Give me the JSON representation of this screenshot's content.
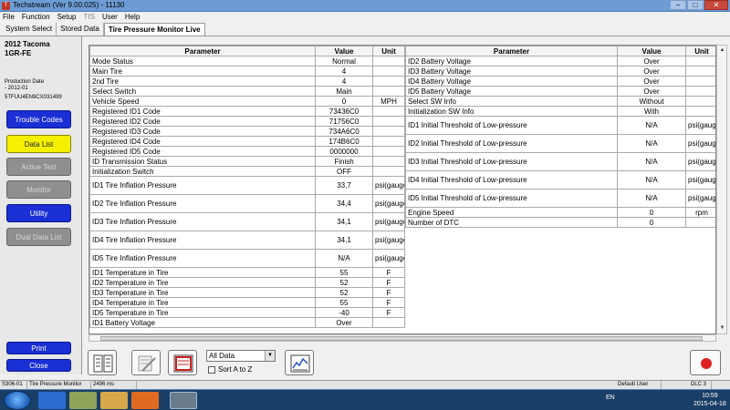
{
  "window": {
    "title": "Techstream (Ver 9.00.025) - 11130"
  },
  "menu": [
    "File",
    "Function",
    "Setup",
    "TIS",
    "User",
    "Help"
  ],
  "tabs": [
    "System Select",
    "Stored Data",
    "Tire Pressure Monitor Live"
  ],
  "vehicle": {
    "model_line1": "2012 Tacoma",
    "model_line2": "1GR-FE",
    "production_label": "Production Date",
    "production_date": "- 2012-01",
    "vin": "5TFUU4EN9CX031499"
  },
  "left_buttons": {
    "trouble_codes": "Trouble Codes",
    "data_list": "Data List",
    "active_test": "Active Test",
    "monitor": "Monitor",
    "utility": "Utility",
    "dual_data_list": "Dual Data List",
    "print": "Print",
    "close": "Close"
  },
  "table_headers": {
    "parameter": "Parameter",
    "value": "Value",
    "unit": "Unit"
  },
  "left_table": [
    {
      "param": "Mode Status",
      "value": "Normal",
      "unit": ""
    },
    {
      "param": "Main Tire",
      "value": "4",
      "unit": ""
    },
    {
      "param": "2nd Tire",
      "value": "4",
      "unit": ""
    },
    {
      "param": "Select Switch",
      "value": "Main",
      "unit": ""
    },
    {
      "param": "Vehicle Speed",
      "value": "0",
      "unit": "MPH"
    },
    {
      "param": "Registered ID1 Code",
      "value": "73436C0",
      "unit": ""
    },
    {
      "param": "Registered ID2 Code",
      "value": "71756C0",
      "unit": ""
    },
    {
      "param": "Registered ID3 Code",
      "value": "734A6C0",
      "unit": ""
    },
    {
      "param": "Registered ID4 Code",
      "value": "174B6C0",
      "unit": ""
    },
    {
      "param": "Registered ID5 Code",
      "value": "0000000",
      "unit": ""
    },
    {
      "param": "ID Transmission Status",
      "value": "Finish",
      "unit": ""
    },
    {
      "param": "Initialization Switch",
      "value": "OFF",
      "unit": ""
    },
    {
      "param": "ID1 Tire Inflation Pressure",
      "value": "33,7",
      "unit": "psi(gauge)"
    },
    {
      "param": "ID2 Tire Inflation Pressure",
      "value": "34,4",
      "unit": "psi(gauge)"
    },
    {
      "param": "ID3 Tire Inflation Pressure",
      "value": "34,1",
      "unit": "psi(gauge)"
    },
    {
      "param": "ID4 Tire Inflation Pressure",
      "value": "34,1",
      "unit": "psi(gauge)"
    },
    {
      "param": "ID5 Tire Inflation Pressure",
      "value": "N/A",
      "unit": "psi(gauge)"
    },
    {
      "param": "ID1 Temperature in Tire",
      "value": "55",
      "unit": "F"
    },
    {
      "param": "ID2 Temperature in Tire",
      "value": "52",
      "unit": "F"
    },
    {
      "param": "ID3 Temperature in Tire",
      "value": "52",
      "unit": "F"
    },
    {
      "param": "ID4 Temperature in Tire",
      "value": "55",
      "unit": "F"
    },
    {
      "param": "ID5 Temperature in Tire",
      "value": "-40",
      "unit": "F"
    },
    {
      "param": "ID1 Battery Voltage",
      "value": "Over",
      "unit": ""
    }
  ],
  "right_table": [
    {
      "param": "ID2 Battery Voltage",
      "value": "Over",
      "unit": ""
    },
    {
      "param": "ID3 Battery Voltage",
      "value": "Over",
      "unit": ""
    },
    {
      "param": "ID4 Battery Voltage",
      "value": "Over",
      "unit": ""
    },
    {
      "param": "ID5 Battery Voltage",
      "value": "Over",
      "unit": ""
    },
    {
      "param": "Select SW Info",
      "value": "Without",
      "unit": ""
    },
    {
      "param": "Initialization SW Info",
      "value": "With",
      "unit": ""
    },
    {
      "param": "ID1 Initial Threshold of Low-pressure",
      "value": "N/A",
      "unit": "psi(gauge)"
    },
    {
      "param": "ID2 Initial Threshold of Low-pressure",
      "value": "N/A",
      "unit": "psi(gauge)"
    },
    {
      "param": "ID3 Initial Threshold of Low-pressure",
      "value": "N/A",
      "unit": "psi(gauge)"
    },
    {
      "param": "ID4 Initial Threshold of Low-pressure",
      "value": "N/A",
      "unit": "psi(gauge)"
    },
    {
      "param": "ID5 Initial Threshold of Low-pressure",
      "value": "N/A",
      "unit": "psi(gauge)"
    },
    {
      "param": "Engine Speed",
      "value": "0",
      "unit": "rpm"
    },
    {
      "param": "Number of DTC",
      "value": "0",
      "unit": ""
    }
  ],
  "toolbar": {
    "filter_value": "All Data",
    "sort_label": "Sort A to Z"
  },
  "status": {
    "code": "S306-01",
    "screen": "Tire Pressure Monitor",
    "timing": "2496 ms",
    "user": "Default User",
    "dlc": "DLC 3"
  },
  "taskbar": {
    "lang": "EN",
    "time": "10:59",
    "date": "2015-04-18"
  },
  "colors": {
    "button_blue": "#1a2fd4",
    "button_yellow": "#f4f000",
    "button_gray": "#8f8f8f"
  }
}
